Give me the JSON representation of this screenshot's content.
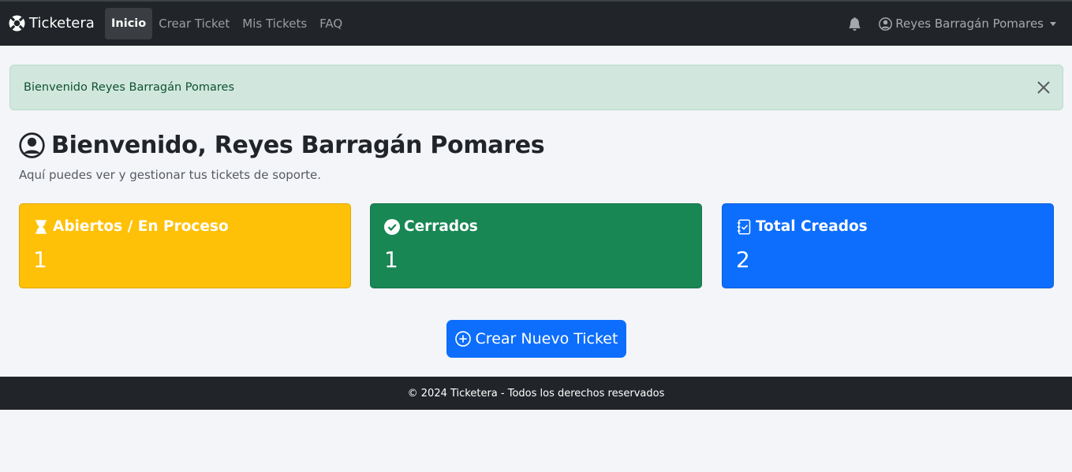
{
  "navbar": {
    "brand": "Ticketera",
    "links": [
      {
        "label": "Inicio",
        "active": true
      },
      {
        "label": "Crear Ticket"
      },
      {
        "label": "Mis Tickets"
      },
      {
        "label": "FAQ"
      }
    ],
    "user_name": "Reyes Barragán Pomares",
    "icons": {
      "brand": "life-ring-icon",
      "bell": "bell-icon",
      "user": "person-circle-icon"
    }
  },
  "alert": {
    "message": "Bienvenido Reyes Barragán Pomares",
    "color": "#d1e7dd"
  },
  "main": {
    "heading": "Bienvenido, Reyes Barragán Pomares",
    "subtitle": "Aquí puedes ver y gestionar tus tickets de soporte.",
    "cards": [
      {
        "title": "Abiertos / En Proceso",
        "value": "1",
        "color": "#ffc107",
        "icon": "hourglass-icon"
      },
      {
        "title": "Cerrados",
        "value": "1",
        "color": "#198754",
        "icon": "check-circle-icon"
      },
      {
        "title": "Total Creados",
        "value": "2",
        "color": "#0d6efd",
        "icon": "journal-check-icon"
      }
    ],
    "create_button": "Crear Nuevo Ticket"
  },
  "footer": {
    "text": "© 2024 Ticketera - Todos los derechos reservados"
  }
}
